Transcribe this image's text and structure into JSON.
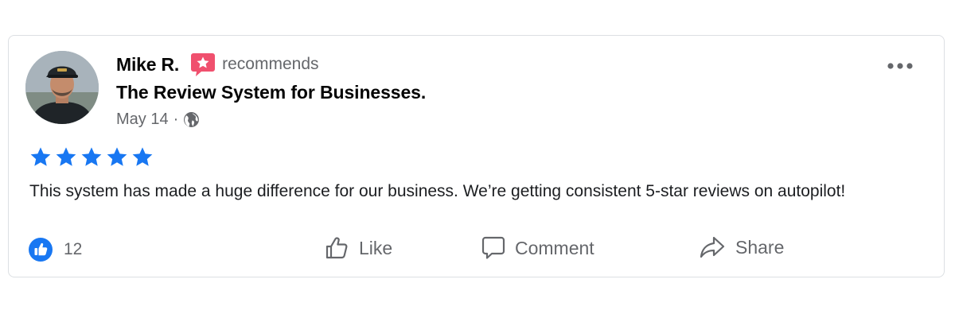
{
  "post": {
    "author": "Mike R.",
    "recommend_text": "recommends",
    "business": "The Review System for Businesses.",
    "date": "May 14",
    "separator": "·",
    "rating": 5,
    "review": "This system has made a huge difference for our business. We’re getting consistent 5-star reviews on autopilot!",
    "like_count": "12"
  },
  "actions": {
    "like": "Like",
    "comment": "Comment",
    "share": "Share"
  },
  "icons": {
    "recommend": "recommend-star-bubble-icon",
    "audience": "globe-icon",
    "menu": "more-horizontal-icon",
    "rating": "star-icon",
    "reaction": "thumbs-up-icon",
    "comment": "comment-icon",
    "share": "share-icon"
  },
  "colors": {
    "accent_blue": "#1877f2",
    "recommend_red": "#f0506e",
    "text_primary": "#050505",
    "text_secondary": "#65676b",
    "border": "#dcdfe3"
  }
}
